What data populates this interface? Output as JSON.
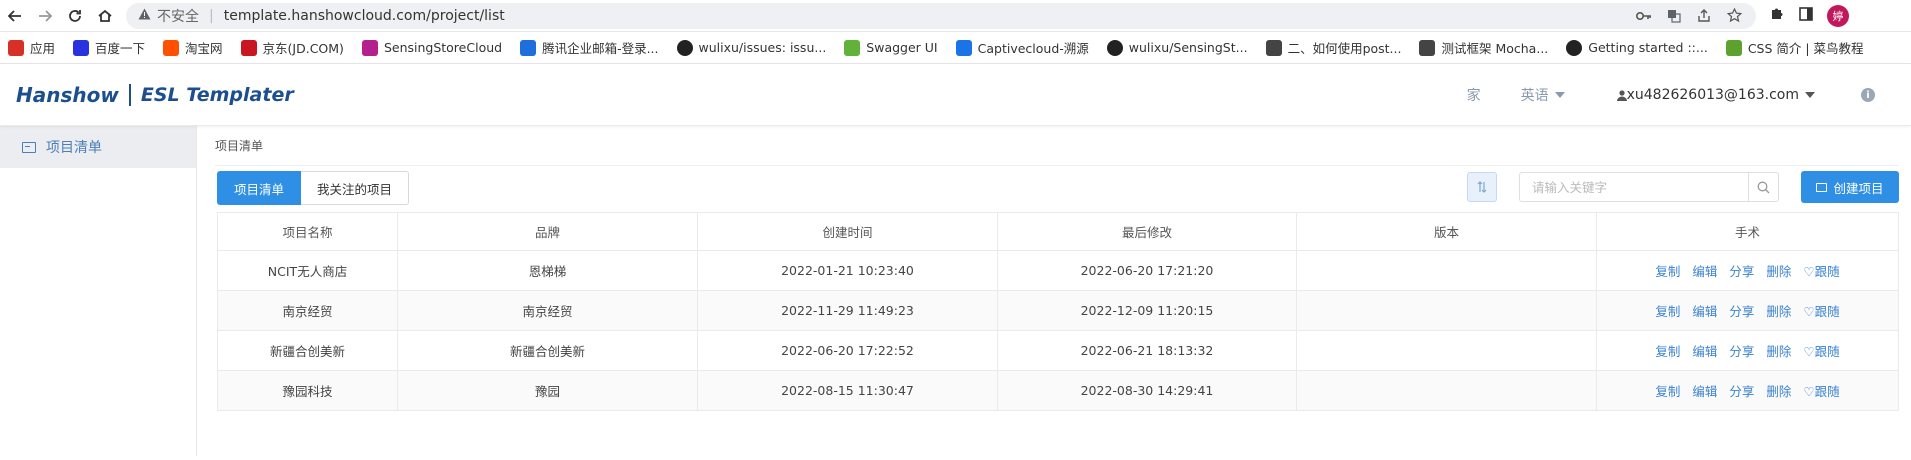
{
  "browser": {
    "insecure_label": "不安全",
    "url": "template.hanshowcloud.com/project/list",
    "profile_initial": "婷",
    "bookmarks": [
      {
        "label": "应用",
        "icon": "apps-grid-icon",
        "color": "#d93025"
      },
      {
        "label": "百度一下",
        "icon": "baidu-paw-icon",
        "color": "#2932e1"
      },
      {
        "label": "淘宝网",
        "icon": "taobao-icon",
        "color": "#ff5000"
      },
      {
        "label": "京东(JD.COM)",
        "icon": "jd-icon",
        "color": "#c91623"
      },
      {
        "label": "SensingStoreCloud",
        "icon": "sensing-icon",
        "color": "#b5208f"
      },
      {
        "label": "腾讯企业邮箱-登录...",
        "icon": "tencent-mail-icon",
        "color": "#1e6fd9"
      },
      {
        "label": "wulixu/issues: issu...",
        "icon": "github-icon",
        "color": "#222222"
      },
      {
        "label": "Swagger UI",
        "icon": "swagger-icon",
        "color": "#62b13b"
      },
      {
        "label": "Captivecloud-溯源",
        "icon": "captivecloud-icon",
        "color": "#1a73e8"
      },
      {
        "label": "wulixu/SensingSt...",
        "icon": "github-icon",
        "color": "#222222"
      },
      {
        "label": "二、如何使用post...",
        "icon": "book-icon",
        "color": "#444444"
      },
      {
        "label": "测试框架 Mocha...",
        "icon": "mocha-icon",
        "color": "#444444"
      },
      {
        "label": "Getting started ::...",
        "icon": "getting-started-icon",
        "color": "#222222"
      },
      {
        "label": "CSS 简介 | 菜鸟教程",
        "icon": "runoob-icon",
        "color": "#5da12e"
      }
    ]
  },
  "header": {
    "logo_brand": "Hanshow",
    "logo_product": "ESL Templater",
    "home_link": "家",
    "language_label": "英语",
    "user_email": "xu482626013@163.com",
    "info": "i"
  },
  "sidebar": {
    "items": [
      {
        "label": "项目清单"
      }
    ]
  },
  "main": {
    "breadcrumb": "项目清单",
    "tabs": [
      {
        "label": "项目清单"
      },
      {
        "label": "我关注的项目"
      }
    ],
    "search_placeholder": "请输入关键字",
    "create_label": "创建项目",
    "table": {
      "headers": [
        "项目名称",
        "品牌",
        "创建时间",
        "最后修改",
        "版本",
        "手术"
      ],
      "rows": [
        [
          "NCIT无人商店",
          "恩梯梯",
          "2022-01-21 10:23:40",
          "2022-06-20 17:21:20",
          ""
        ],
        [
          "南京经贸",
          "南京经贸",
          "2022-11-29 11:49:23",
          "2022-12-09 11:20:15",
          ""
        ],
        [
          "新疆合创美新",
          "新疆合创美新",
          "2022-06-20 17:22:52",
          "2022-06-21 18:13:32",
          ""
        ],
        [
          "豫园科技",
          "豫园",
          "2022-08-15 11:30:47",
          "2022-08-30 14:29:41",
          ""
        ]
      ],
      "actions": [
        "复制",
        "编辑",
        "分享",
        "删除",
        "♡跟随"
      ]
    }
  }
}
